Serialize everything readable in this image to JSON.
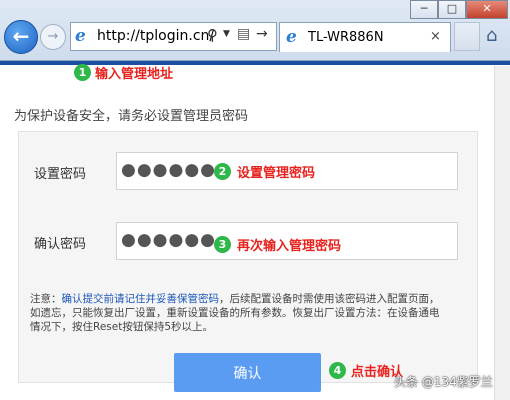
{
  "browser": {
    "url": "http://tplogin.cn/",
    "tab_title": "TL-WR886N",
    "tab_close": "×",
    "back_glyph": "←",
    "forward_glyph": "→",
    "window_buttons": [
      "─",
      "□",
      "✕"
    ],
    "icons": [
      "ie-icon",
      "search-icon",
      "compat-view-icon",
      "refresh-icon",
      "home-icon"
    ]
  },
  "annotations": {
    "step1": {
      "num": "1",
      "text": "输入管理地址"
    },
    "step2": {
      "num": "2",
      "text": "设置管理密码"
    },
    "step3": {
      "num": "3",
      "text": "再次输入管理密码"
    },
    "step4": {
      "num": "4",
      "text": "点击确认"
    }
  },
  "page": {
    "intro": "为保护设备安全，请务必设置管理员密码",
    "password_label": "设置密码",
    "password_value": "●●●●●●",
    "confirm_label": "确认密码",
    "confirm_value": "●●●●●●",
    "note_prefix": "注意：",
    "note_link": "确认提交前请记住并妥善保管密码",
    "note_rest": "，后续配置设备时需使用该密码进入配置页面，如遗忘，只能恢复出厂设置，重新设置设备的所有参数。恢复出厂设置方法：在设备通电情况下，按住Reset按钮保持5秒以上。",
    "confirm_button": "确认"
  },
  "watermark": "头条 @134紫罗兰",
  "colors": {
    "accent": "#5a9cf2",
    "annotation": "#e8231f",
    "badge": "#2fb84a",
    "link": "#1a56b8"
  }
}
